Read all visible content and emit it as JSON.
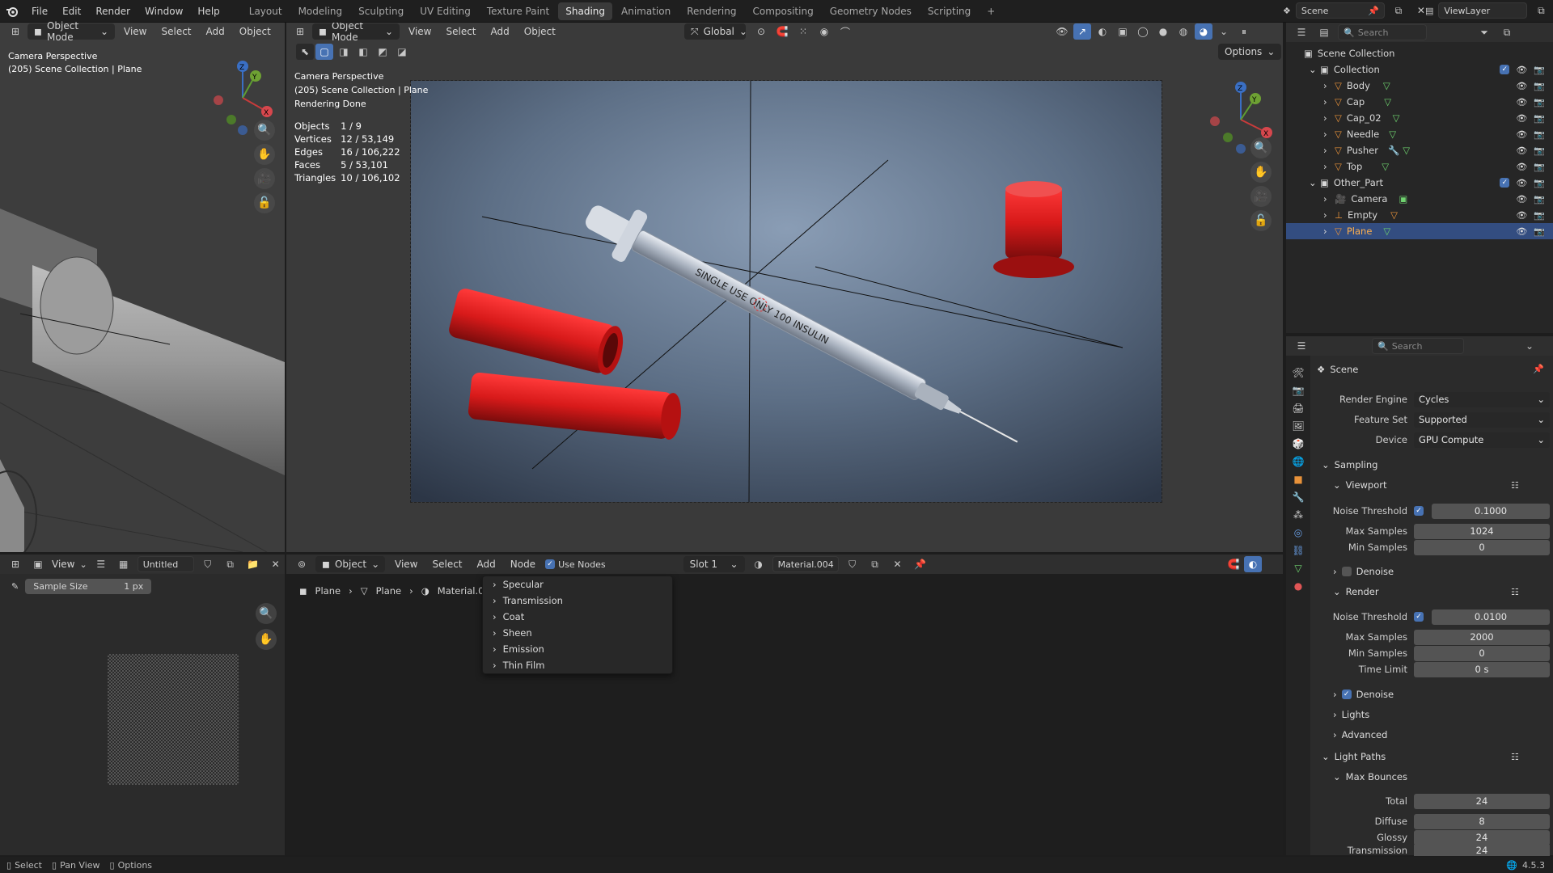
{
  "topbar": {
    "menus": [
      "File",
      "Edit",
      "Render",
      "Window",
      "Help"
    ],
    "workspaces": [
      "Layout",
      "Modeling",
      "Sculpting",
      "UV Editing",
      "Texture Paint",
      "Shading",
      "Animation",
      "Rendering",
      "Compositing",
      "Geometry Nodes",
      "Scripting"
    ],
    "active_workspace": "Shading",
    "add_tab": "+",
    "scene": "Scene",
    "view_layer": "ViewLayer"
  },
  "left_viewport": {
    "mode": "Object Mode",
    "menus": [
      "View",
      "Select",
      "Add",
      "Object"
    ],
    "overlay_line1": "Camera Perspective",
    "overlay_line2": "(205) Scene Collection | Plane"
  },
  "main_viewport": {
    "mode": "Object Mode",
    "menus": [
      "View",
      "Select",
      "Add",
      "Object"
    ],
    "transform_orientation": "Global",
    "options_label": "Options",
    "overlay_line1": "Camera Perspective",
    "overlay_line2": "(205) Scene Collection | Plane",
    "overlay_line3": "Rendering Done",
    "stats": [
      {
        "label": "Objects",
        "value": "1 / 9"
      },
      {
        "label": "Vertices",
        "value": "12 / 53,149"
      },
      {
        "label": "Edges",
        "value": "16 / 106,222"
      },
      {
        "label": "Faces",
        "value": "5 / 53,101"
      },
      {
        "label": "Triangles",
        "value": "10 / 106,102"
      }
    ],
    "syringe_label": "SINGLE USE ONLY  100 INSULIN"
  },
  "image_editor": {
    "view_label": "View",
    "image_name": "Untitled",
    "sample_size_label": "Sample Size",
    "sample_size_value": "1 px"
  },
  "node_editor": {
    "type": "Object",
    "menus": [
      "View",
      "Select",
      "Add",
      "Node"
    ],
    "use_nodes_label": "Use Nodes",
    "slot": "Slot 1",
    "material": "Material.004",
    "breadcrumb": [
      "Plane",
      "Plane",
      "Material.004"
    ],
    "popup_items": [
      "Specular",
      "Transmission",
      "Coat",
      "Sheen",
      "Emission",
      "Thin Film"
    ]
  },
  "outliner": {
    "search_placeholder": "Search",
    "root": "Scene Collection",
    "items": [
      {
        "name": "Collection",
        "level": 1,
        "type": "collection"
      },
      {
        "name": "Body",
        "level": 2,
        "type": "mesh"
      },
      {
        "name": "Cap",
        "level": 2,
        "type": "mesh"
      },
      {
        "name": "Cap_02",
        "level": 2,
        "type": "mesh"
      },
      {
        "name": "Needle",
        "level": 2,
        "type": "mesh"
      },
      {
        "name": "Pusher",
        "level": 2,
        "type": "mesh"
      },
      {
        "name": "Top",
        "level": 2,
        "type": "mesh"
      },
      {
        "name": "Other_Part",
        "level": 1,
        "type": "collection"
      },
      {
        "name": "Camera",
        "level": 2,
        "type": "camera"
      },
      {
        "name": "Empty",
        "level": 2,
        "type": "empty"
      },
      {
        "name": "Plane",
        "level": 2,
        "type": "mesh",
        "selected": true
      }
    ]
  },
  "properties": {
    "search_placeholder": "Search",
    "context": "Scene",
    "render_engine_label": "Render Engine",
    "render_engine": "Cycles",
    "feature_set_label": "Feature Set",
    "feature_set": "Supported",
    "device_label": "Device",
    "device": "GPU Compute",
    "sampling": "Sampling",
    "viewport": "Viewport",
    "noise_threshold_label": "Noise Threshold",
    "viewport_noise_threshold": "0.1000",
    "max_samples_label": "Max Samples",
    "viewport_max_samples": "1024",
    "min_samples_label": "Min Samples",
    "viewport_min_samples": "0",
    "denoise_label": "Denoise",
    "render": "Render",
    "render_noise_threshold": "0.0100",
    "render_max_samples": "2000",
    "render_min_samples": "0",
    "time_limit_label": "Time Limit",
    "time_limit": "0 s",
    "lights": "Lights",
    "advanced": "Advanced",
    "light_paths": "Light Paths",
    "max_bounces": "Max Bounces",
    "total_label": "Total",
    "total": "24",
    "diffuse_label": "Diffuse",
    "diffuse": "8",
    "glossy_label": "Glossy",
    "glossy": "24",
    "transmission_label": "Transmission",
    "transmission": "24"
  },
  "statusbar": {
    "select": "Select",
    "pan_view": "Pan View",
    "options": "Options",
    "version": "4.5.3"
  }
}
